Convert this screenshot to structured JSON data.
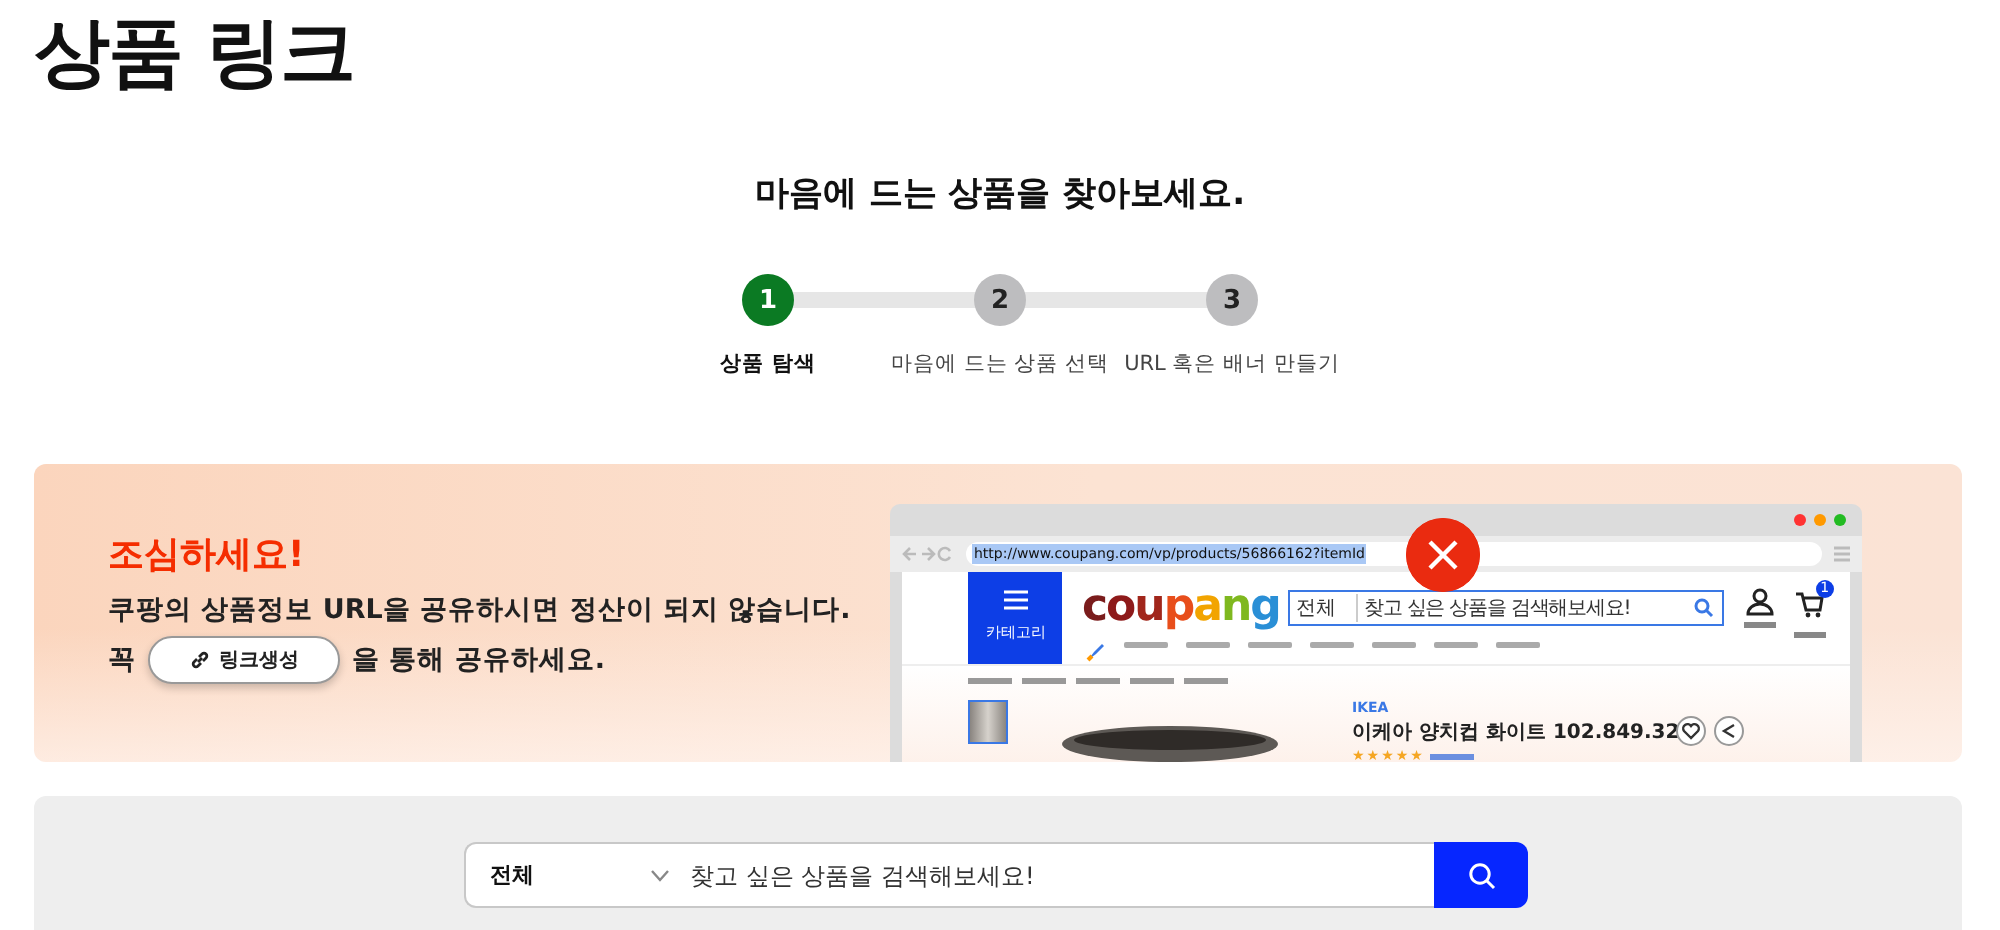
{
  "page_title": "상품 링크",
  "subtitle": "마음에 드는 상품을 찾아보세요.",
  "steps": [
    {
      "number": "1",
      "label": "상품 탐색",
      "selected": true
    },
    {
      "number": "2",
      "label": "마음에 드는 상품 선택",
      "selected": false
    },
    {
      "number": "3",
      "label": "URL 혹은 배너 만들기",
      "selected": false
    }
  ],
  "banner": {
    "heading": "조심하세요!",
    "message": "쿠팡의 상품정보 URL을 공유하시면 정산이 되지 않습니다.",
    "prefix": "꼭",
    "button": "링크생성",
    "suffix": "을 통해 공유하세요.",
    "mockup": {
      "url": "http://www.coupang.com/vp/products/56866162?itemId",
      "menu_label": "카테고리",
      "logo": "coupang",
      "search_category": "전체",
      "search_placeholder": "찾고 싶은 상품을 검색해보세요!",
      "cart_count": "1",
      "brand": "IKEA",
      "product_title": "이케아 양치컵 화이트 102.849.32",
      "stars": 5
    }
  },
  "search": {
    "category": "전체",
    "placeholder": "찾고 싶은 상품을 검색해보세요!"
  }
}
